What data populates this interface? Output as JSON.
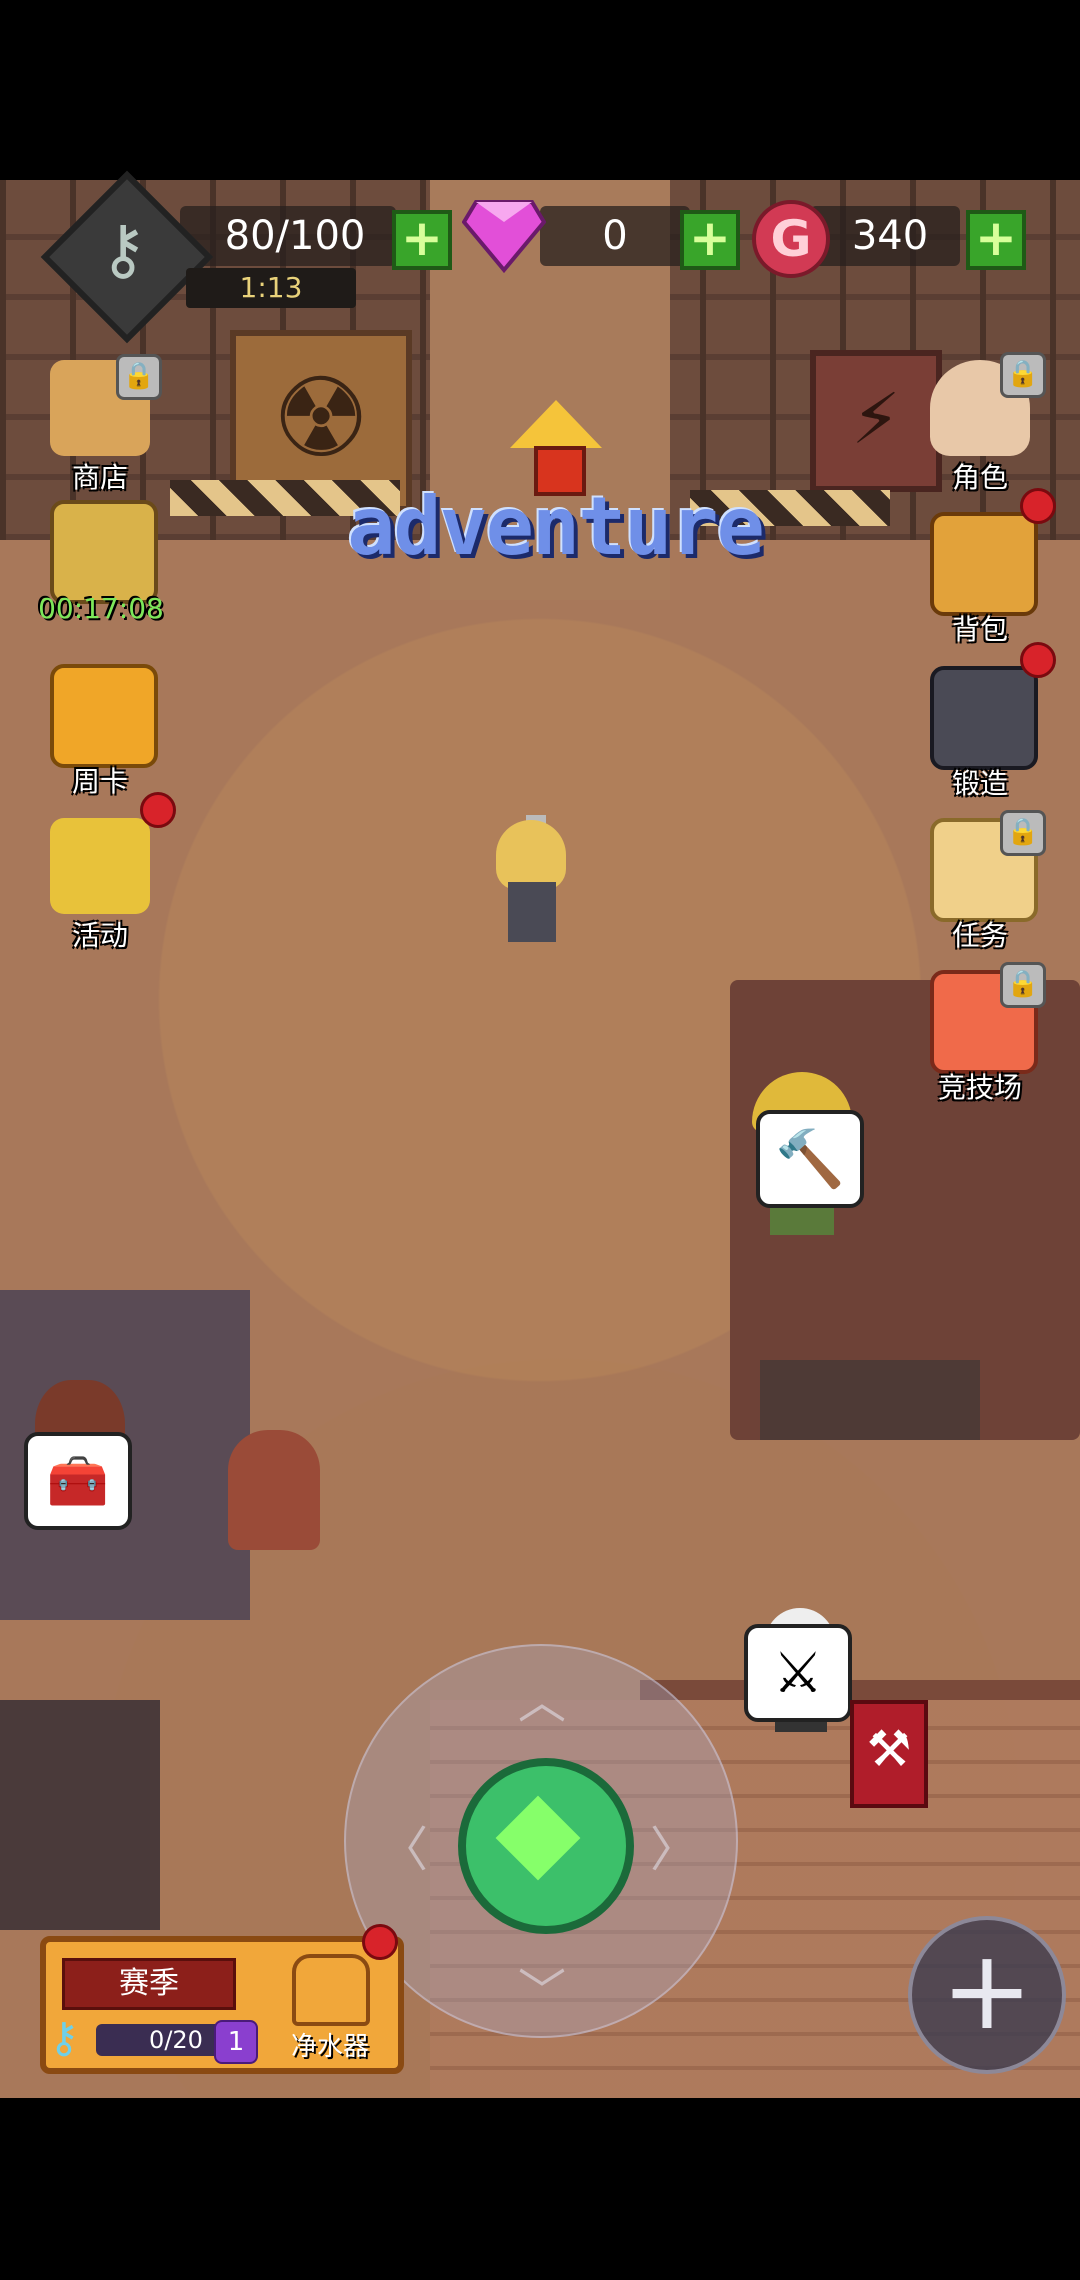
{
  "resources": {
    "energy": {
      "value": "80/100",
      "icon": "key-icon",
      "timer": "1:13",
      "plus": "+"
    },
    "gems": {
      "value": "0",
      "icon": "gem-icon",
      "plus": "+"
    },
    "gold": {
      "value": "340",
      "icon": "g-coin-icon",
      "letter": "G",
      "plus": "+"
    }
  },
  "adventure": {
    "label": "adventure"
  },
  "left_menu": {
    "shop": {
      "label": "商店",
      "locked": true
    },
    "chest": {
      "timer": "00:17:08"
    },
    "weekly_card": {
      "label": "周卡"
    },
    "events": {
      "label": "活动",
      "badge": true
    }
  },
  "right_menu": {
    "character": {
      "label": "角色",
      "locked": true
    },
    "backpack": {
      "label": "背包",
      "badge": true
    },
    "forge": {
      "label": "锻造",
      "badge": true
    },
    "tasks": {
      "label": "任务",
      "locked": true
    },
    "arena": {
      "label": "竞技场",
      "locked": true
    }
  },
  "season": {
    "title": "赛季",
    "progress": "0/20",
    "level": "1",
    "purifier_label": "净水器",
    "badge": true
  },
  "colors": {
    "plus_green": "#39a52a",
    "gem_pink": "#e24fd8",
    "gold_red": "#d23a54",
    "joystick_green": "#3cc06a",
    "badge_red": "#d8232a",
    "adventure_blue": "#6f8fe8"
  }
}
